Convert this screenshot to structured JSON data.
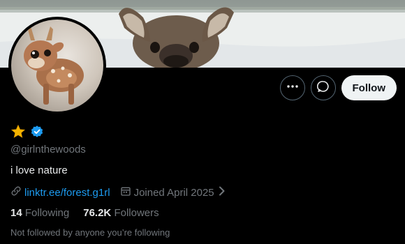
{
  "profile": {
    "handle": "@girlnthewoods",
    "bio": "i love nature",
    "link": "linktr.ee/forest.g1rl",
    "joined": "Joined April 2025",
    "following_count": "14",
    "following_label": "Following",
    "followers_count": "76.2K",
    "followers_label": "Followers",
    "not_followed_text": "Not followed by anyone you’re following"
  },
  "actions": {
    "follow_label": "Follow"
  },
  "icons": {
    "more": "more-horizontal-icon",
    "message": "message-bubble-icon",
    "star": "star-emoji-icon",
    "verified": "verified-badge-icon",
    "link": "link-icon",
    "calendar": "calendar-icon",
    "chevron": "chevron-right-icon"
  },
  "colors": {
    "accent": "#1d9bf0",
    "secondary_text": "#71767b",
    "follow_bg": "#eff3f4"
  }
}
